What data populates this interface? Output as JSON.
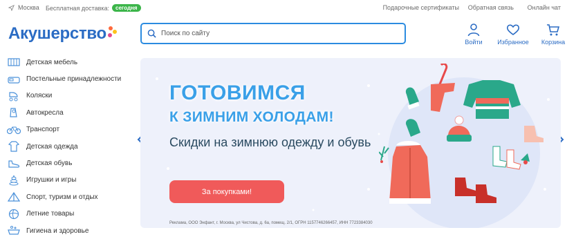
{
  "topbar": {
    "city": "Москва",
    "delivery_label": "Бесплатная доставка:",
    "delivery_badge": "сегодня",
    "links": [
      "Подарочные сертификаты",
      "Обратная связь",
      "Онлайн чат"
    ]
  },
  "header": {
    "logo": "Акушерство",
    "search_placeholder": "Поиск по сайту",
    "actions": {
      "login": "Войти",
      "favorites": "Избранное",
      "cart": "Корзина"
    }
  },
  "sidebar": {
    "items": [
      "Детская мебель",
      "Постельные принадлежности",
      "Коляски",
      "Автокресла",
      "Транспорт",
      "Детская одежда",
      "Детская обувь",
      "Игрушки и игры",
      "Спорт, туризм и отдых",
      "Летние товары",
      "Гигиена и здоровье"
    ]
  },
  "banner": {
    "headline1": "ГОТОВИМСЯ",
    "headline2": "К ЗИМНИМ ХОЛОДАМ!",
    "subtitle": "Скидки на зимнюю одежду и обувь",
    "cta": "За покупками!",
    "legal": "Реклама, ООО Энфант, г. Москва, ул Чистова, д. 6а, помещ. 2/1, ОГРН 1157746266457, ИНН 7723384030"
  },
  "colors": {
    "brand_blue": "#2b6cc4",
    "accent_red": "#f05a5a",
    "badge_green": "#3cb54a",
    "headline_blue": "#3aa0e8"
  }
}
